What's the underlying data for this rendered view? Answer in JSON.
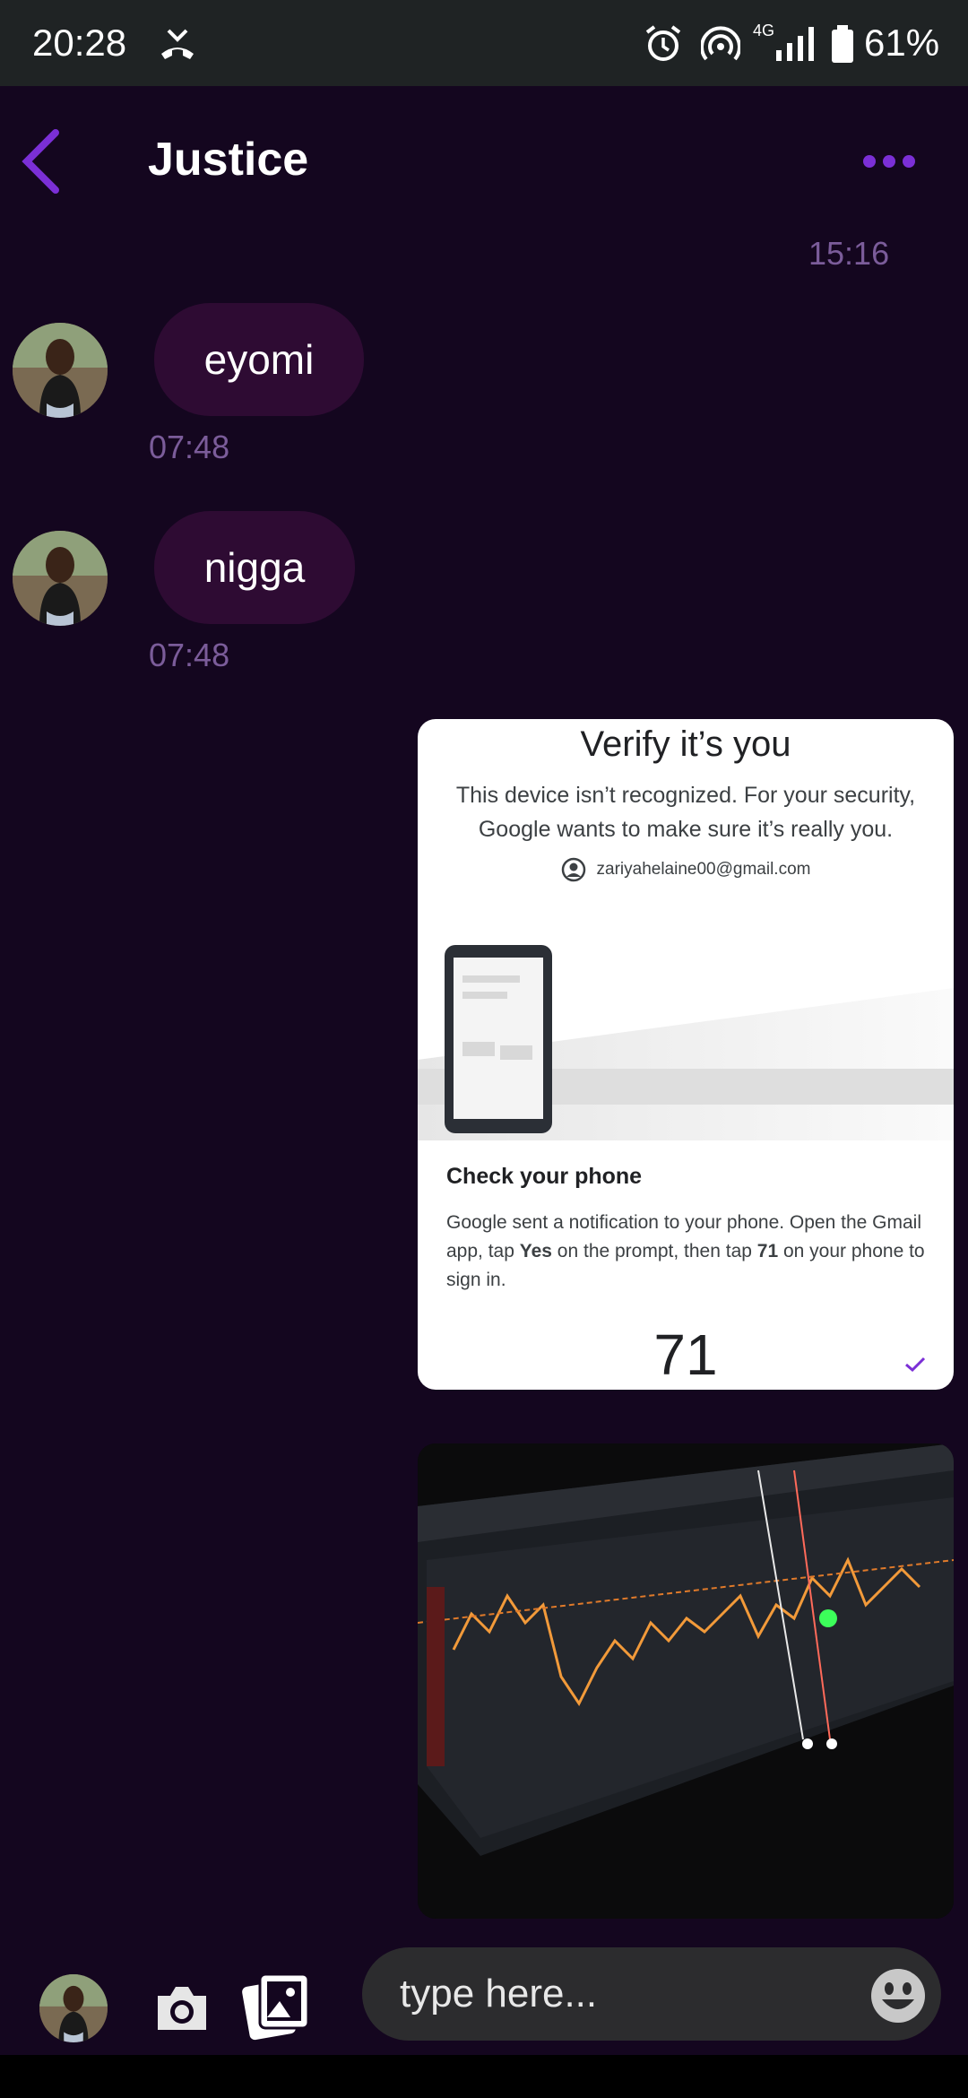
{
  "status_bar": {
    "time": "20:28",
    "network": "4G",
    "battery": "61%",
    "icons": [
      "missed-call-icon",
      "alarm-icon",
      "hotspot-icon",
      "signal-icon",
      "battery-icon"
    ]
  },
  "header": {
    "title": "Justice",
    "back_icon": "chevron-left-icon",
    "more_icon": "more-dots-icon",
    "accent": "#7b2fd6"
  },
  "messages": {
    "top_timestamp": "15:16",
    "items": [
      {
        "text": "eyomi",
        "time": "07:48"
      },
      {
        "text": "nigga",
        "time": "07:48"
      }
    ]
  },
  "image_message": {
    "title": "Verify it’s you",
    "description": "This device isn’t recognized. For your security, Google wants to make sure it’s really you.",
    "email": "zariyahelaine00@gmail.com",
    "check_title": "Check your phone",
    "check_desc_pre": "Google sent a notification to your phone. Open the Gmail app, tap ",
    "check_desc_yes": "Yes",
    "check_desc_mid": " on the prompt, then tap ",
    "check_desc_num": "71",
    "check_desc_post": " on your phone to sign in.",
    "number": "71"
  },
  "composer": {
    "placeholder": "type here...",
    "icons": [
      "camera-icon",
      "gallery-icon",
      "emoji-icon"
    ]
  },
  "colors": {
    "background": "#14061f",
    "bubble": "#2e0b33",
    "timestamp": "#7b5c9a"
  }
}
